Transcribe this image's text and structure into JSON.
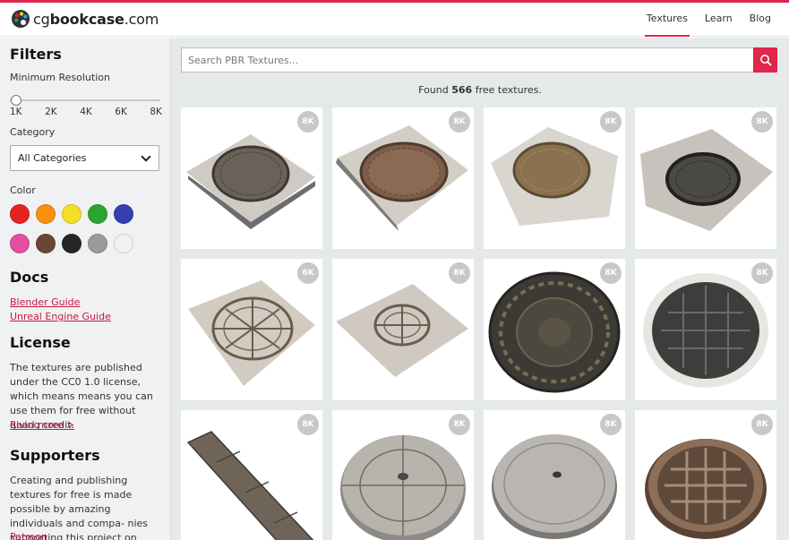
{
  "brand": {
    "logo_prefix": "cg",
    "logo_bold": "bookcase",
    "logo_suffix": ".com"
  },
  "nav": [
    {
      "label": "Textures",
      "active": true
    },
    {
      "label": "Learn",
      "active": false
    },
    {
      "label": "Blog",
      "active": false
    }
  ],
  "sidebar": {
    "filters_title": "Filters",
    "min_res_label": "Minimum Resolution",
    "res_ticks": [
      "1K",
      "2K",
      "4K",
      "6K",
      "8K"
    ],
    "category_label": "Category",
    "category_value": "All Categories",
    "color_label": "Color",
    "colors": [
      "#e52222",
      "#f7900f",
      "#f1e025",
      "#2aa52f",
      "#3340ae",
      "#e2509f",
      "#6b4537",
      "#262626",
      "#9a9a9a",
      "#f1f1f1"
    ],
    "docs_title": "Docs",
    "docs_links": [
      "Blender Guide",
      "Unreal Engine Guide"
    ],
    "license_title": "License",
    "license_text": "The textures are published under the CC0 1.0 license, which means means you can use them for free without giving credit.",
    "read_more": "Read more >",
    "supporters_title": "Supporters",
    "supporters_text": "Creating and publishing textures for free is made possible by amazing individuals and compa- nies supporting this project on",
    "patreon": "Patreon"
  },
  "search": {
    "placeholder": "Search PBR Textures..."
  },
  "results": {
    "prefix": "Found ",
    "count": "566",
    "suffix": " free textures."
  },
  "textures": [
    {
      "res": "8K",
      "kind": "square-round"
    },
    {
      "res": "8K",
      "kind": "square-round-rust"
    },
    {
      "res": "8K",
      "kind": "square-round-gold"
    },
    {
      "res": "8K",
      "kind": "square-round-dark"
    },
    {
      "res": "6K",
      "kind": "square-wheel"
    },
    {
      "res": "8K",
      "kind": "square-wheel-small"
    },
    {
      "res": "8K",
      "kind": "disk-ornate"
    },
    {
      "res": "8K",
      "kind": "disk-grid-white"
    },
    {
      "res": "8K",
      "kind": "panel-long"
    },
    {
      "res": "8K",
      "kind": "disk-concrete-lines"
    },
    {
      "res": "8K",
      "kind": "disk-concrete"
    },
    {
      "res": "8K",
      "kind": "disk-rust-grid"
    }
  ]
}
